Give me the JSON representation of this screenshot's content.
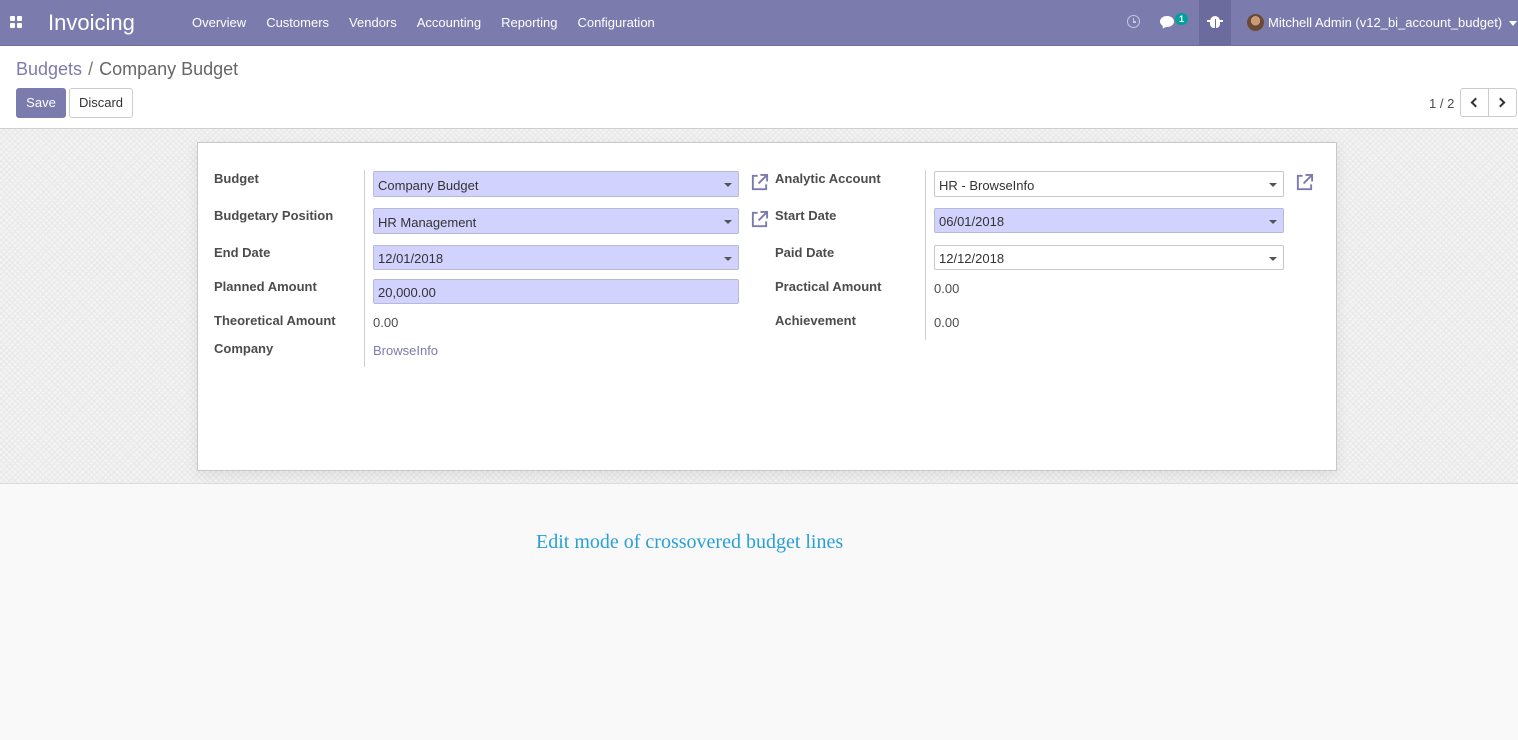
{
  "navbar": {
    "app_title": "Invoicing",
    "menu": [
      "Overview",
      "Customers",
      "Vendors",
      "Accounting",
      "Reporting",
      "Configuration"
    ],
    "chat_badge": "1",
    "user": "Mitchell Admin (v12_bi_account_budget)",
    "icons": [
      "apps-icon",
      "clock-icon",
      "chat-icon",
      "bug-icon",
      "avatar"
    ],
    "bg_color": "#7c7bad"
  },
  "control_panel": {
    "breadcrumb": {
      "parent": "Budgets",
      "separator": "/",
      "current": "Company Budget"
    },
    "save_label": "Save",
    "discard_label": "Discard",
    "pager": "1 / 2"
  },
  "form": {
    "left": {
      "budget": {
        "label": "Budget",
        "value": "Company Budget"
      },
      "budgetary_position": {
        "label": "Budgetary Position",
        "value": "HR Management"
      },
      "end_date": {
        "label": "End Date",
        "value": "12/01/2018"
      },
      "planned_amount": {
        "label": "Planned Amount",
        "value": "20,000.00"
      },
      "theoretical_amount": {
        "label": "Theoretical Amount",
        "value": "0.00"
      },
      "company": {
        "label": "Company",
        "value": "BrowseInfo"
      }
    },
    "right": {
      "analytic_account": {
        "label": "Analytic Account",
        "value": "HR - BrowseInfo"
      },
      "start_date": {
        "label": "Start Date",
        "value": "06/01/2018"
      },
      "paid_date": {
        "label": "Paid Date",
        "value": "12/12/2018"
      },
      "practical_amount": {
        "label": "Practical Amount",
        "value": "0.00"
      },
      "achievement": {
        "label": "Achievement",
        "value": "0.00"
      }
    },
    "required_field_color": "#d2d2ff"
  },
  "caption": "Edit mode of crossovered budget lines"
}
